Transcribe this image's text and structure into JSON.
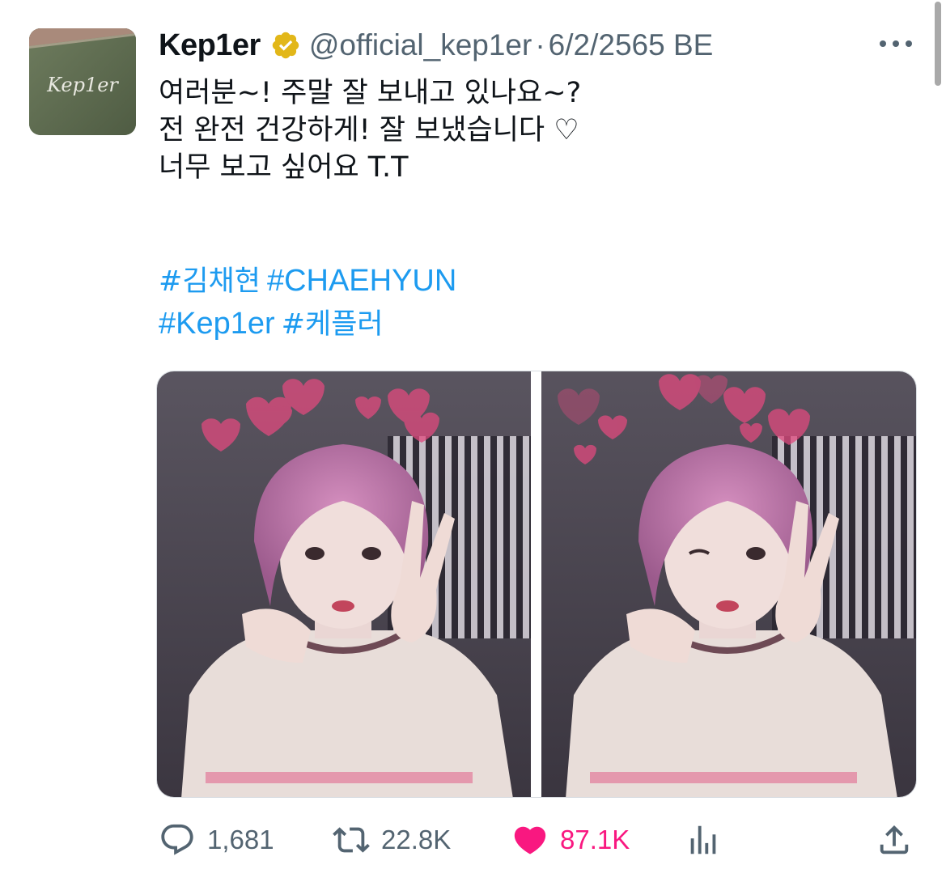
{
  "tweet": {
    "display_name": "Kep1er",
    "handle": "@official_kep1er",
    "separator": "·",
    "date": "6/2/2565 BE",
    "avatar_text": "Kep1er",
    "text_lines": [
      "여러분~! 주말 잘 보내고 있나요~?",
      "전 완전 건강하게! 잘 보냈습니다 ♡",
      "너무 보고 싶어요 T.T"
    ],
    "hashtags": [
      "#김채현",
      "#CHAEHYUN",
      "#Kep1er",
      "#케플러"
    ],
    "media_count": 2
  },
  "actions": {
    "replies": "1,681",
    "retweets": "22.8K",
    "likes": "87.1K"
  },
  "icons": {
    "verified": "verified-badge-icon",
    "more": "more-icon",
    "reply": "reply-icon",
    "retweet": "retweet-icon",
    "like": "heart-icon",
    "views": "views-icon",
    "share": "share-icon"
  },
  "colors": {
    "link": "#1d9bf0",
    "like": "#f91880",
    "verified_gold": "#e2b719",
    "muted": "#536471"
  }
}
